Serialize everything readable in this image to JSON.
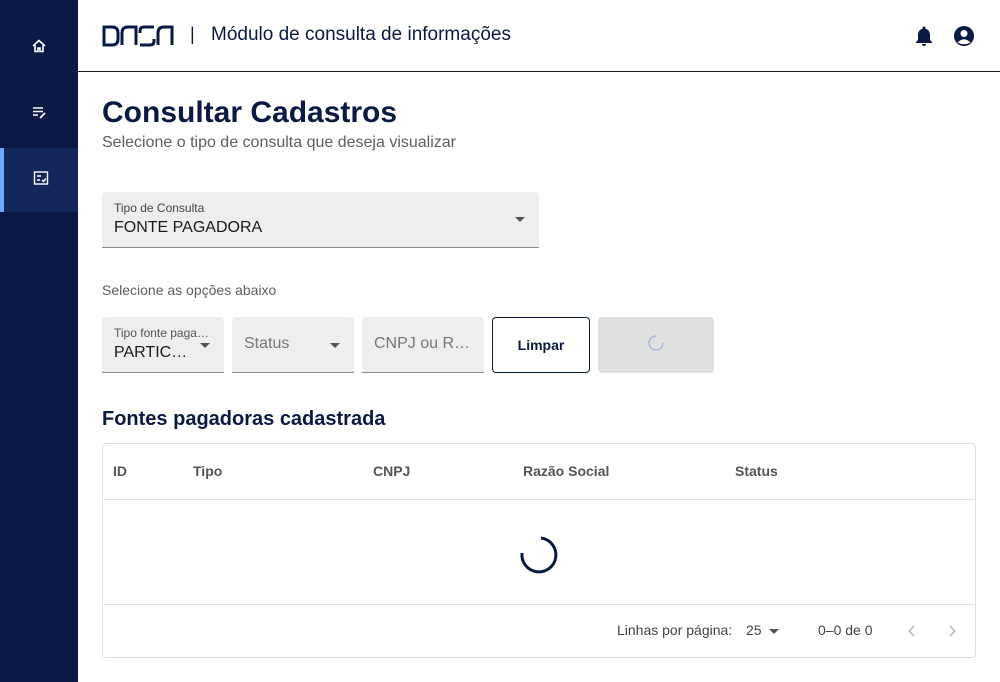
{
  "header": {
    "logo_text": "DASA",
    "separator": "|",
    "title": "Módulo de consulta de informações"
  },
  "sidebar": {
    "items": [
      {
        "icon": "home-icon"
      },
      {
        "icon": "edit-list-icon"
      },
      {
        "icon": "checklist-icon",
        "active": true
      }
    ]
  },
  "page": {
    "title": "Consultar Cadastros",
    "subtitle": "Selecione o tipo de consulta que deseja visualizar"
  },
  "consulta": {
    "label": "Tipo de Consulta",
    "value": "FONTE PAGADORA"
  },
  "filters": {
    "section_label": "Selecione as opções abaixo",
    "tipo_fonte_label": "Tipo fonte pagadora",
    "tipo_fonte_value": "PARTICULAR",
    "status_placeholder": "Status",
    "cnpj_placeholder": "CNPJ ou Razão Social",
    "clear_label": "Limpar"
  },
  "table": {
    "title": "Fontes pagadoras cadastrada",
    "columns": [
      "ID",
      "Tipo",
      "CNPJ",
      "Razão Social",
      "Status"
    ],
    "rows": []
  },
  "pagination": {
    "rows_per_page_label": "Linhas por página:",
    "rows_per_page": "25",
    "range": "0–0 de 0"
  },
  "colors": {
    "navy": "#0a1a45",
    "accent": "#6fa8ff"
  }
}
